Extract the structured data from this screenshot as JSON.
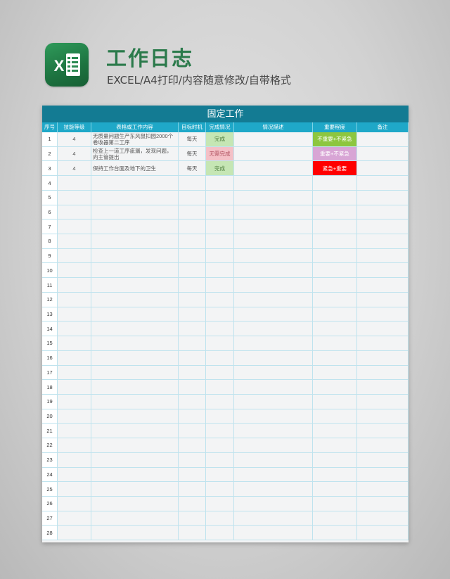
{
  "header": {
    "title": "工作日志",
    "subtitle": "EXCEL/A4打印/内容随意修改/自带格式"
  },
  "logo": {
    "icon": "excel-icon",
    "letter": "X"
  },
  "sheet": {
    "banner": "固定工作",
    "columns": [
      "序号",
      "技能等级",
      "表格或工作内容",
      "目标时机",
      "完成情况",
      "情况描述",
      "重要程度",
      "备注"
    ],
    "rows": [
      {
        "no": "1",
        "level": "4",
        "content": "无质量问题生产东风鼠扣园2000个 卷收器第二工序",
        "timing": "每天",
        "status": "完成",
        "desc": "",
        "priority": "不重要+不紧急",
        "note": ""
      },
      {
        "no": "2",
        "level": "4",
        "content": "检查上一道工序疵漏，发现问题， 向主管提出",
        "timing": "每天",
        "status": "无需完成",
        "desc": "",
        "priority": "重要+不紧急",
        "note": ""
      },
      {
        "no": "3",
        "level": "4",
        "content": "保持工作台面及地下的卫生",
        "timing": "每天",
        "status": "完成",
        "desc": "",
        "priority": "紧急+重要",
        "note": ""
      },
      {
        "no": "4",
        "level": "",
        "content": "",
        "timing": "",
        "status": "",
        "desc": "",
        "priority": "",
        "note": ""
      },
      {
        "no": "5",
        "level": "",
        "content": "",
        "timing": "",
        "status": "",
        "desc": "",
        "priority": "",
        "note": ""
      },
      {
        "no": "6",
        "level": "",
        "content": "",
        "timing": "",
        "status": "",
        "desc": "",
        "priority": "",
        "note": ""
      },
      {
        "no": "7",
        "level": "",
        "content": "",
        "timing": "",
        "status": "",
        "desc": "",
        "priority": "",
        "note": ""
      },
      {
        "no": "8",
        "level": "",
        "content": "",
        "timing": "",
        "status": "",
        "desc": "",
        "priority": "",
        "note": ""
      },
      {
        "no": "9",
        "level": "",
        "content": "",
        "timing": "",
        "status": "",
        "desc": "",
        "priority": "",
        "note": ""
      },
      {
        "no": "10",
        "level": "",
        "content": "",
        "timing": "",
        "status": "",
        "desc": "",
        "priority": "",
        "note": ""
      },
      {
        "no": "11",
        "level": "",
        "content": "",
        "timing": "",
        "status": "",
        "desc": "",
        "priority": "",
        "note": ""
      },
      {
        "no": "12",
        "level": "",
        "content": "",
        "timing": "",
        "status": "",
        "desc": "",
        "priority": "",
        "note": ""
      },
      {
        "no": "13",
        "level": "",
        "content": "",
        "timing": "",
        "status": "",
        "desc": "",
        "priority": "",
        "note": ""
      },
      {
        "no": "14",
        "level": "",
        "content": "",
        "timing": "",
        "status": "",
        "desc": "",
        "priority": "",
        "note": ""
      },
      {
        "no": "15",
        "level": "",
        "content": "",
        "timing": "",
        "status": "",
        "desc": "",
        "priority": "",
        "note": ""
      },
      {
        "no": "16",
        "level": "",
        "content": "",
        "timing": "",
        "status": "",
        "desc": "",
        "priority": "",
        "note": ""
      },
      {
        "no": "17",
        "level": "",
        "content": "",
        "timing": "",
        "status": "",
        "desc": "",
        "priority": "",
        "note": ""
      },
      {
        "no": "18",
        "level": "",
        "content": "",
        "timing": "",
        "status": "",
        "desc": "",
        "priority": "",
        "note": ""
      },
      {
        "no": "19",
        "level": "",
        "content": "",
        "timing": "",
        "status": "",
        "desc": "",
        "priority": "",
        "note": ""
      },
      {
        "no": "20",
        "level": "",
        "content": "",
        "timing": "",
        "status": "",
        "desc": "",
        "priority": "",
        "note": ""
      },
      {
        "no": "21",
        "level": "",
        "content": "",
        "timing": "",
        "status": "",
        "desc": "",
        "priority": "",
        "note": ""
      },
      {
        "no": "22",
        "level": "",
        "content": "",
        "timing": "",
        "status": "",
        "desc": "",
        "priority": "",
        "note": ""
      },
      {
        "no": "23",
        "level": "",
        "content": "",
        "timing": "",
        "status": "",
        "desc": "",
        "priority": "",
        "note": ""
      },
      {
        "no": "24",
        "level": "",
        "content": "",
        "timing": "",
        "status": "",
        "desc": "",
        "priority": "",
        "note": ""
      },
      {
        "no": "25",
        "level": "",
        "content": "",
        "timing": "",
        "status": "",
        "desc": "",
        "priority": "",
        "note": ""
      },
      {
        "no": "26",
        "level": "",
        "content": "",
        "timing": "",
        "status": "",
        "desc": "",
        "priority": "",
        "note": ""
      },
      {
        "no": "27",
        "level": "",
        "content": "",
        "timing": "",
        "status": "",
        "desc": "",
        "priority": "",
        "note": ""
      },
      {
        "no": "28",
        "level": "",
        "content": "",
        "timing": "",
        "status": "",
        "desc": "",
        "priority": "",
        "note": ""
      }
    ]
  },
  "colors": {
    "title": "#2b7a4b",
    "banner": "#137b93",
    "header": "#1fa8c8",
    "status": {
      "完成": "#c5e6b4",
      "无需完成": "#f4c0c6"
    },
    "status_text": {
      "完成": "#4a7a3a",
      "无需完成": "#b0505f"
    },
    "priority": {
      "不重要+不紧急": "#8dc63f",
      "重要+不紧急": "#d8a5d5",
      "紧急+重要": "#ff0000"
    }
  }
}
